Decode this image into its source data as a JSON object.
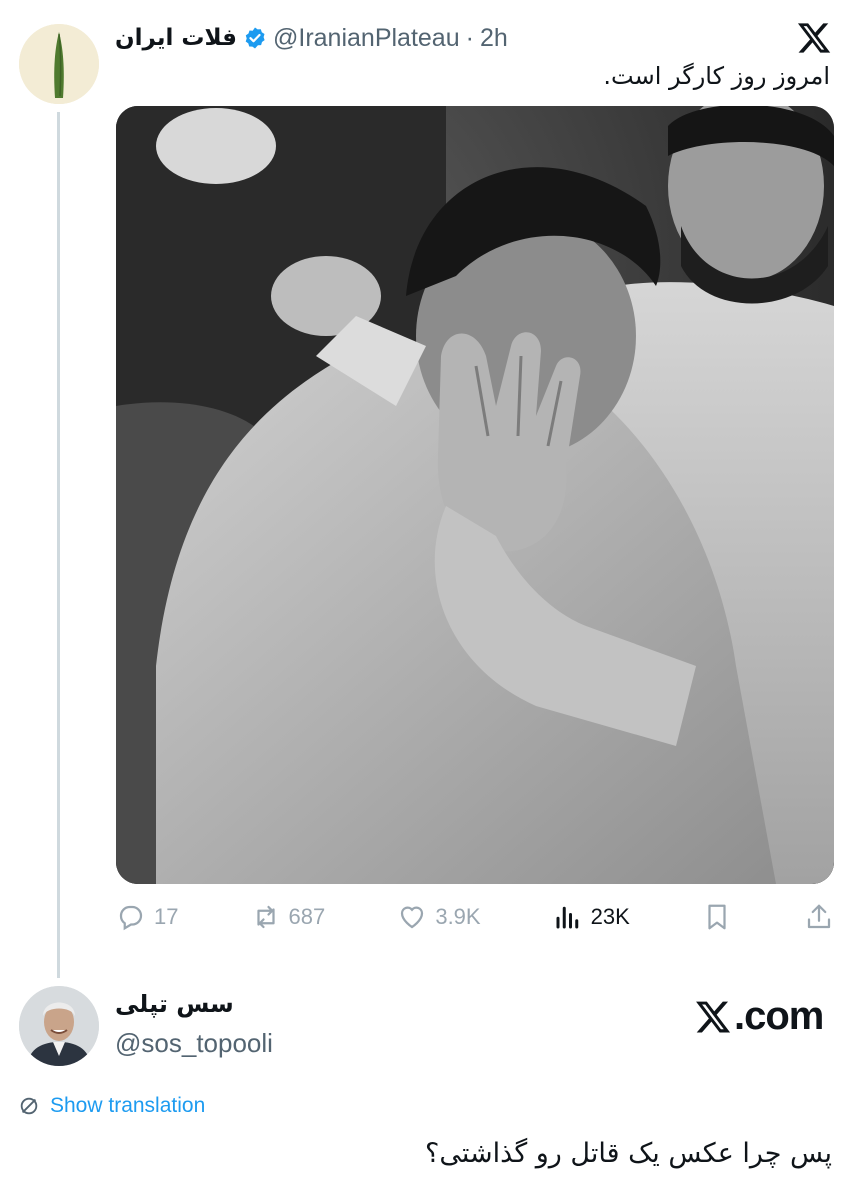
{
  "tweet": {
    "author_name": "فلات ایران",
    "handle": "@IranianPlateau",
    "separator": "·",
    "time": "2h",
    "text": "امروز روز کارگر است.",
    "photo_icon": "photo-grayscale-man-covering-face",
    "stats": {
      "replies": "17",
      "reposts": "687",
      "likes": "3.9K",
      "views": "23K"
    },
    "icons": [
      "reply-icon",
      "repost-icon",
      "like-icon",
      "views-icon",
      "bookmark-icon",
      "share-icon"
    ]
  },
  "reply": {
    "author_name": "سس تپلی",
    "handle": "@sos_topooli",
    "show_translation": "Show translation",
    "text": "پس چرا عکس یک قاتل رو گذاشتی؟"
  },
  "brand": {
    "x_com": ".com",
    "verified_color": "#1d9bf0",
    "link_color": "#1d9bf0"
  }
}
